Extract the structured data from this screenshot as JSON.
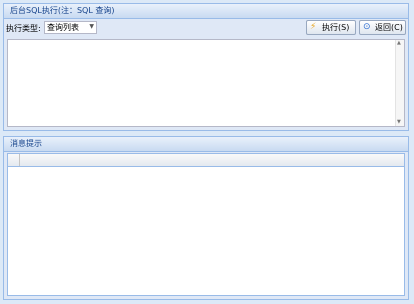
{
  "top_panel": {
    "title": "后台SQL执行(注：SQL 查询)",
    "exec_type_label": "执行类型:",
    "exec_type_value": "查询列表",
    "execute_button": "执行(S)",
    "back_button": "返回(C)",
    "sql_text": ""
  },
  "bottom_panel": {
    "title": "消息提示"
  }
}
